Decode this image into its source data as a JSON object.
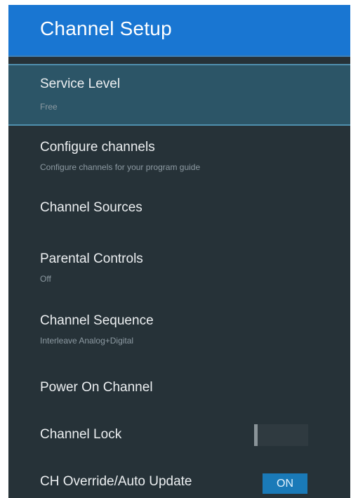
{
  "header": {
    "title": "Channel Setup"
  },
  "menu": {
    "items": [
      {
        "title": "Service Level",
        "subtitle": "Free"
      },
      {
        "title": "Configure channels",
        "subtitle": "Configure channels for your program guide"
      },
      {
        "title": "Channel Sources",
        "subtitle": ""
      },
      {
        "title": "Parental Controls",
        "subtitle": "Off"
      },
      {
        "title": "Channel Sequence",
        "subtitle": "Interleave Analog+Digital"
      },
      {
        "title": "Power On Channel",
        "subtitle": ""
      },
      {
        "title": "Channel Lock",
        "subtitle": "",
        "toggle_state": "off"
      },
      {
        "title": "CH Override/Auto Update",
        "subtitle": "",
        "toggle_label": "ON"
      }
    ]
  },
  "colors": {
    "header_bg": "#1976d2",
    "panel_bg": "#263238",
    "selected_bg": "#2c5567",
    "toggle_on_bg": "#1a7ab8"
  }
}
